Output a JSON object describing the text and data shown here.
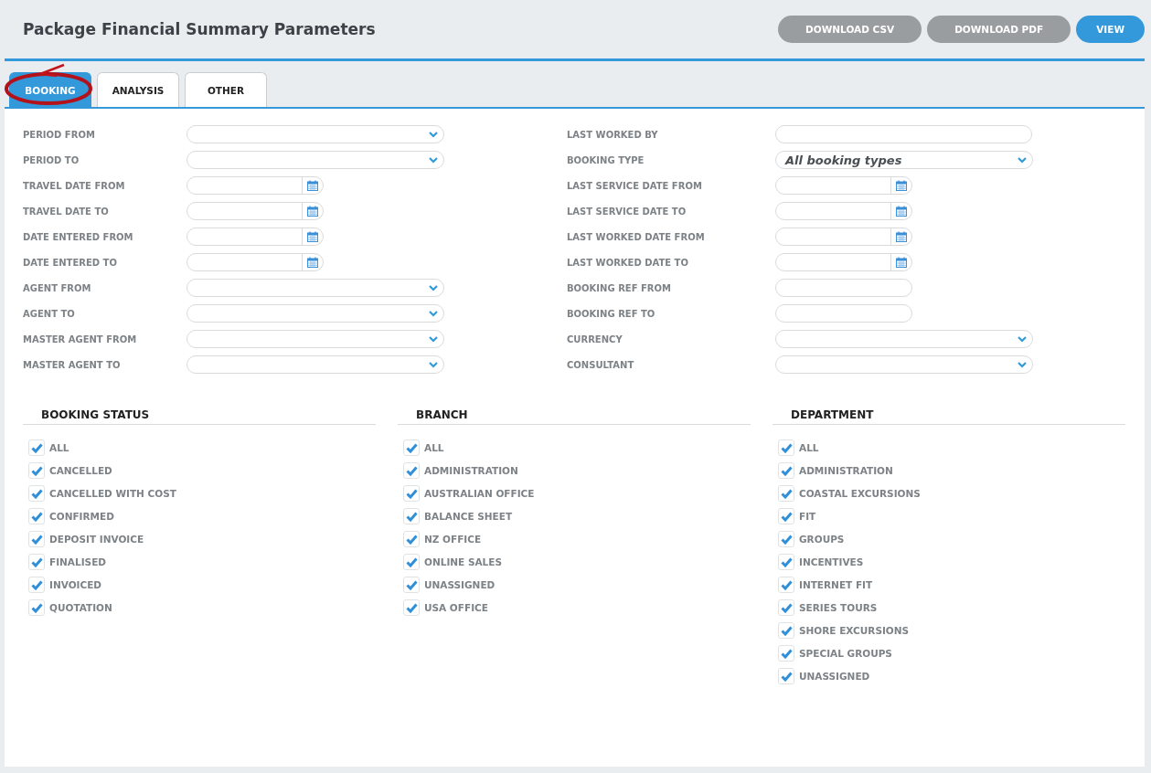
{
  "header": {
    "title": "Package Financial Summary Parameters",
    "buttons": [
      {
        "label": "DOWNLOAD CSV",
        "kind": "secondary"
      },
      {
        "label": "DOWNLOAD PDF",
        "kind": "secondary"
      },
      {
        "label": "VIEW",
        "kind": "primary"
      }
    ]
  },
  "tabs": [
    {
      "label": "BOOKING",
      "selected": true,
      "circled": true
    },
    {
      "label": "ANALYSIS",
      "selected": false,
      "circled": false
    },
    {
      "label": "OTHER",
      "selected": false,
      "circled": false
    }
  ],
  "left_fields": [
    {
      "label": "PERIOD FROM",
      "kind": "select"
    },
    {
      "label": "PERIOD TO",
      "kind": "select"
    },
    {
      "label": "TRAVEL DATE FROM",
      "kind": "date"
    },
    {
      "label": "TRAVEL DATE TO",
      "kind": "date"
    },
    {
      "label": "DATE ENTERED FROM",
      "kind": "date"
    },
    {
      "label": "DATE ENTERED TO",
      "kind": "date"
    },
    {
      "label": "AGENT FROM",
      "kind": "select"
    },
    {
      "label": "AGENT TO",
      "kind": "select"
    },
    {
      "label": "MASTER AGENT FROM",
      "kind": "select"
    },
    {
      "label": "MASTER AGENT TO",
      "kind": "select"
    }
  ],
  "right_fields": [
    {
      "label": "LAST WORKED BY",
      "kind": "text"
    },
    {
      "label": "BOOKING TYPE",
      "kind": "select",
      "value": "All booking types"
    },
    {
      "label": "LAST SERVICE DATE FROM",
      "kind": "date"
    },
    {
      "label": "LAST SERVICE DATE TO",
      "kind": "date"
    },
    {
      "label": "LAST WORKED DATE FROM",
      "kind": "date"
    },
    {
      "label": "LAST WORKED DATE TO",
      "kind": "date"
    },
    {
      "label": "BOOKING REF FROM",
      "kind": "short"
    },
    {
      "label": "BOOKING REF TO",
      "kind": "short"
    },
    {
      "label": "CURRENCY",
      "kind": "select"
    },
    {
      "label": "CONSULTANT",
      "kind": "select"
    }
  ],
  "checklists": [
    {
      "title": "BOOKING STATUS",
      "items": [
        {
          "label": "ALL",
          "checked": true
        },
        {
          "label": "CANCELLED",
          "checked": true
        },
        {
          "label": "CANCELLED WITH COST",
          "checked": true
        },
        {
          "label": "CONFIRMED",
          "checked": true
        },
        {
          "label": "DEPOSIT INVOICE",
          "checked": true
        },
        {
          "label": "FINALISED",
          "checked": true
        },
        {
          "label": "INVOICED",
          "checked": true
        },
        {
          "label": "QUOTATION",
          "checked": true
        }
      ]
    },
    {
      "title": "BRANCH",
      "items": [
        {
          "label": "ALL",
          "checked": true
        },
        {
          "label": "ADMINISTRATION",
          "checked": true
        },
        {
          "label": "AUSTRALIAN OFFICE",
          "checked": true
        },
        {
          "label": "BALANCE SHEET",
          "checked": true
        },
        {
          "label": "NZ OFFICE",
          "checked": true
        },
        {
          "label": "ONLINE SALES",
          "checked": true
        },
        {
          "label": "UNASSIGNED",
          "checked": true
        },
        {
          "label": "USA OFFICE",
          "checked": true
        }
      ]
    },
    {
      "title": "DEPARTMENT",
      "items": [
        {
          "label": "ALL",
          "checked": true
        },
        {
          "label": "ADMINISTRATION",
          "checked": true
        },
        {
          "label": "COASTAL EXCURSIONS",
          "checked": true
        },
        {
          "label": "FIT",
          "checked": true
        },
        {
          "label": "GROUPS",
          "checked": true
        },
        {
          "label": "INCENTIVES",
          "checked": true
        },
        {
          "label": "INTERNET FIT",
          "checked": true
        },
        {
          "label": "SERIES TOURS",
          "checked": true
        },
        {
          "label": "SHORE EXCURSIONS",
          "checked": true
        },
        {
          "label": "SPECIAL GROUPS",
          "checked": true
        },
        {
          "label": "UNASSIGNED",
          "checked": true
        }
      ]
    }
  ]
}
